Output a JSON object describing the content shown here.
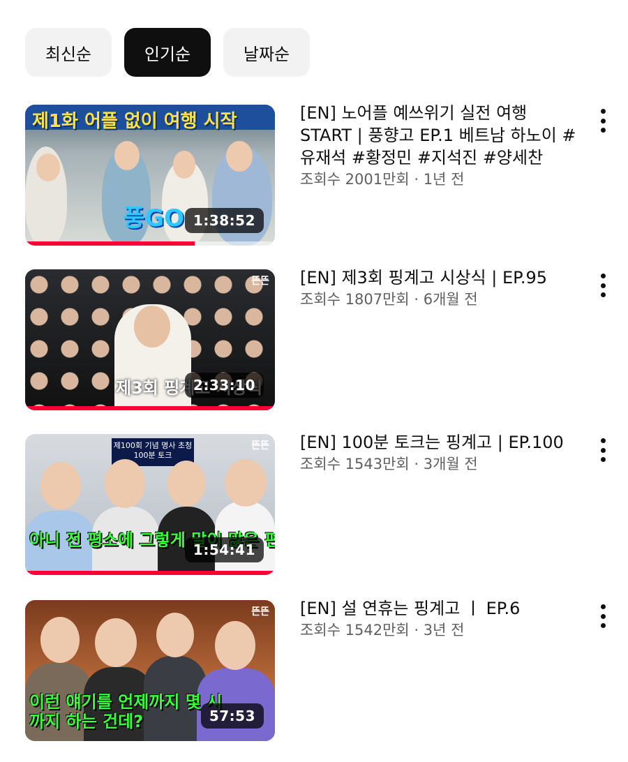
{
  "chips": [
    {
      "label": "최신순",
      "active": false
    },
    {
      "label": "인기순",
      "active": true
    },
    {
      "label": "날짜순",
      "active": false
    }
  ],
  "videos": [
    {
      "title": "[EN] 노어플 예쓰위기 실전 여행 START | 풍향고 EP.1 베트남 하노이 #유재석 #황정민 #지석진 #양세찬",
      "meta": "조회수 2001만회 · 1년 전",
      "duration": "1:38:52",
      "progress": 0.68,
      "thumb_text": "제1화 어플 없이 여행 시작",
      "thumb_logo": "풍GO"
    },
    {
      "title": "[EN] 제3회 핑계고 시상식 | EP.95",
      "meta": "조회수 1807만회 · 6개월 전",
      "duration": "2:33:10",
      "progress": 1.0,
      "thumb_text": "제3회 핑계고 시상식",
      "thumb_logo": "뜬뜬"
    },
    {
      "title": "[EN] 100분 토크는 핑계고 | EP.100",
      "meta": "조회수 1543만회 · 3개월 전",
      "duration": "1:54:41",
      "progress": 1.0,
      "thumb_text": "아니 전 평소에 그렇게 말이 많은 편이 아니라서",
      "thumb_sign": "제100회 기념 명사 초청 100분 토크",
      "thumb_logo": "뜬뜬"
    },
    {
      "title": "[EN] 설 연휴는 핑계고 ㅣ EP.6",
      "meta": "조회수 1542만회 · 3년 전",
      "duration": "57:53",
      "progress": 0,
      "thumb_text": "이런 얘기를 언제까지 몇 시까지 하는 건데?",
      "thumb_logo": "뜬뜬"
    }
  ]
}
